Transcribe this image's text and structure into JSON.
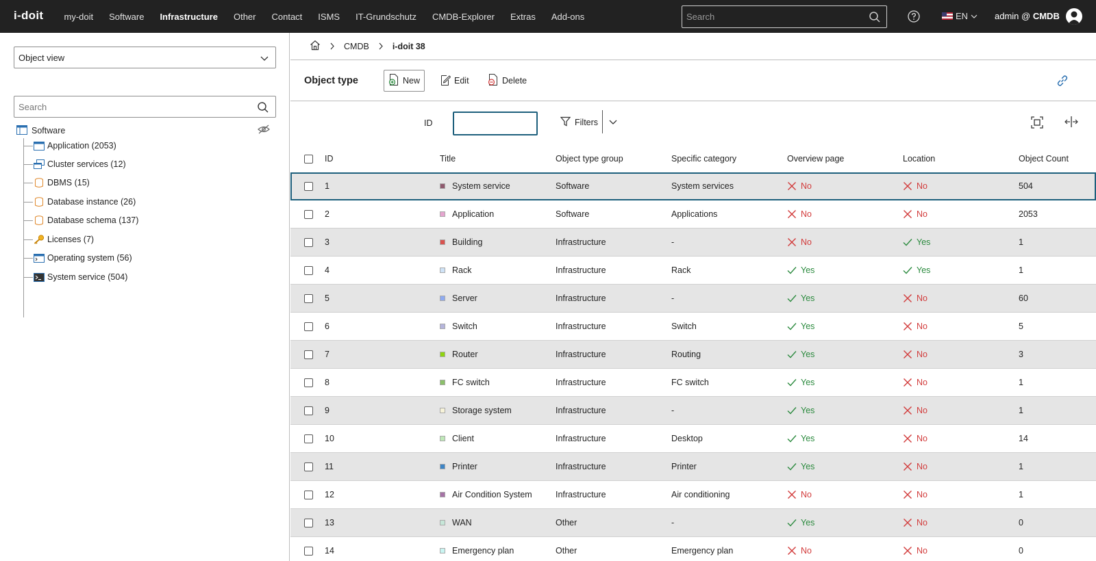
{
  "topbar": {
    "logo": "i-doit",
    "nav": [
      "my-doit",
      "Software",
      "Infrastructure",
      "Other",
      "Contact",
      "ISMS",
      "IT-Grundschutz",
      "CMDB-Explorer",
      "Extras",
      "Add-ons"
    ],
    "active_nav": "Infrastructure",
    "search_placeholder": "Search",
    "language": "EN",
    "user": "admin @",
    "tenant": "CMDB"
  },
  "sidebar": {
    "view_select": "Object view",
    "search_placeholder": "Search",
    "root_label": "Software",
    "items": [
      {
        "label": "Application (2053)",
        "icon": "application-icon"
      },
      {
        "label": "Cluster services (12)",
        "icon": "cluster-services-icon"
      },
      {
        "label": "DBMS (15)",
        "icon": "dbms-icon"
      },
      {
        "label": "Database instance (26)",
        "icon": "database-instance-icon"
      },
      {
        "label": "Database schema (137)",
        "icon": "database-schema-icon"
      },
      {
        "label": "Licenses (7)",
        "icon": "key-icon"
      },
      {
        "label": "Operating system (56)",
        "icon": "operating-system-icon"
      },
      {
        "label": "System service (504)",
        "icon": "terminal-icon"
      }
    ]
  },
  "breadcrumb": {
    "home": "home-icon",
    "items": [
      "CMDB",
      "i-doit 38"
    ]
  },
  "toolbar": {
    "title": "Object type",
    "new_label": "New",
    "edit_label": "Edit",
    "delete_label": "Delete"
  },
  "filterbar": {
    "id_label": "ID",
    "id_value": "",
    "filters_label": "Filters"
  },
  "table": {
    "headers": {
      "id": "ID",
      "title": "Title",
      "group": "Object type group",
      "specific": "Specific category",
      "overview": "Overview page",
      "location": "Location",
      "count": "Object Count"
    },
    "rows": [
      {
        "id": "1",
        "title": "System service",
        "color": "#8f5a6e",
        "group": "Software",
        "specific": "System services",
        "overview": "No",
        "location": "No",
        "count": "504"
      },
      {
        "id": "2",
        "title": "Application",
        "color": "#e5a5cf",
        "group": "Software",
        "specific": "Applications",
        "overview": "No",
        "location": "No",
        "count": "2053"
      },
      {
        "id": "3",
        "title": "Building",
        "color": "#d9534f",
        "group": "Infrastructure",
        "specific": "-",
        "overview": "No",
        "location": "Yes",
        "count": "1"
      },
      {
        "id": "4",
        "title": "Rack",
        "color": "#cfe3f7",
        "group": "Infrastructure",
        "specific": "Rack",
        "overview": "Yes",
        "location": "Yes",
        "count": "1"
      },
      {
        "id": "5",
        "title": "Server",
        "color": "#8eaaf0",
        "group": "Infrastructure",
        "specific": "-",
        "overview": "Yes",
        "location": "No",
        "count": "60"
      },
      {
        "id": "6",
        "title": "Switch",
        "color": "#b5b5dc",
        "group": "Infrastructure",
        "specific": "Switch",
        "overview": "Yes",
        "location": "No",
        "count": "5"
      },
      {
        "id": "7",
        "title": "Router",
        "color": "#8fd40f",
        "group": "Infrastructure",
        "specific": "Routing",
        "overview": "Yes",
        "location": "No",
        "count": "3"
      },
      {
        "id": "8",
        "title": "FC switch",
        "color": "#8bc06a",
        "group": "Infrastructure",
        "specific": "FC switch",
        "overview": "Yes",
        "location": "No",
        "count": "1"
      },
      {
        "id": "9",
        "title": "Storage system",
        "color": "#f7f3d9",
        "group": "Infrastructure",
        "specific": "-",
        "overview": "Yes",
        "location": "No",
        "count": "1"
      },
      {
        "id": "10",
        "title": "Client",
        "color": "#bfe8b8",
        "group": "Infrastructure",
        "specific": "Desktop",
        "overview": "Yes",
        "location": "No",
        "count": "14"
      },
      {
        "id": "11",
        "title": "Printer",
        "color": "#3d85c6",
        "group": "Infrastructure",
        "specific": "Printer",
        "overview": "Yes",
        "location": "No",
        "count": "1"
      },
      {
        "id": "12",
        "title": "Air Condition System",
        "color": "#a673a6",
        "group": "Infrastructure",
        "specific": "Air conditioning",
        "overview": "No",
        "location": "No",
        "count": "1"
      },
      {
        "id": "13",
        "title": "WAN",
        "color": "#c6e6d8",
        "group": "Other",
        "specific": "-",
        "overview": "Yes",
        "location": "No",
        "count": "0"
      },
      {
        "id": "14",
        "title": "Emergency plan",
        "color": "#c9f5f2",
        "group": "Other",
        "specific": "Emergency plan",
        "overview": "No",
        "location": "No",
        "count": "0"
      }
    ]
  },
  "colors": {
    "topbar_bg": "#222222",
    "accent": "#1d5f7c",
    "no_red": "#d23b3b",
    "yes_green": "#2b8a3e",
    "row_alt": "#e5e5e5"
  }
}
